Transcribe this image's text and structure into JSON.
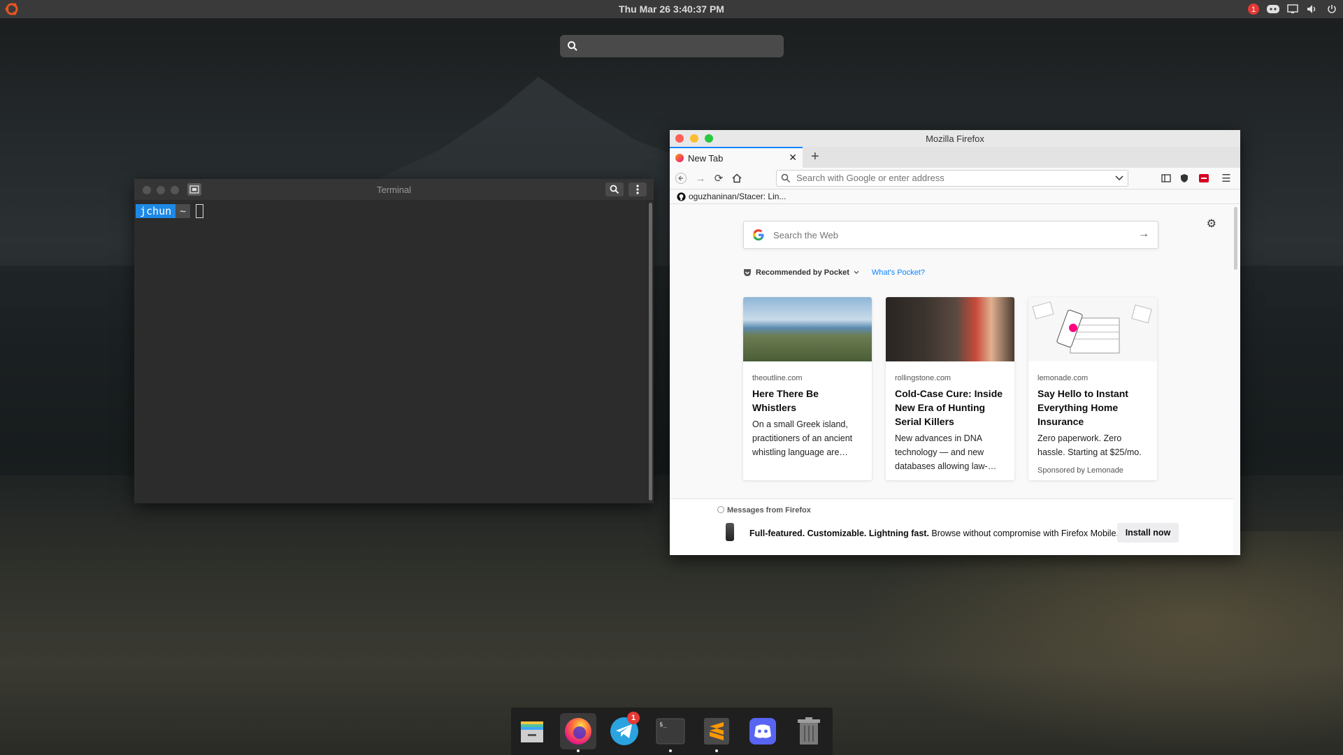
{
  "topbar": {
    "clock": "Thu Mar 26   3:40:37 PM",
    "notification_count": "1"
  },
  "top_search": {
    "value": ""
  },
  "terminal": {
    "title": "Terminal",
    "prompt_user": "jchun",
    "prompt_dir": "~"
  },
  "firefox": {
    "window_title": "Mozilla Firefox",
    "tab_label": "New Tab",
    "url_placeholder": "Search with Google or enter address",
    "bookmark": "oguzhaninan/Stacer: Lin...",
    "web_search_placeholder": "Search the Web",
    "pocket_heading": "Recommended by Pocket",
    "whats_pocket": "What's Pocket?",
    "cards": [
      {
        "source": "theoutline.com",
        "title": "Here There Be Whistlers",
        "desc": "On a small Greek island, practitioners of an ancient whistling language are…",
        "sponsored": ""
      },
      {
        "source": "rollingstone.com",
        "title": "Cold-Case Cure: Inside New Era of Hunting Serial Killers",
        "desc": "New advances in DNA technology — and new databases allowing law-…",
        "sponsored": ""
      },
      {
        "source": "lemonade.com",
        "title": "Say Hello to Instant Everything Home Insurance",
        "desc": "Zero paperwork. Zero hassle. Starting at $25/mo.",
        "sponsored": "Sponsored by Lemonade"
      }
    ],
    "message": {
      "header": "Messages from Firefox",
      "bold": "Full-featured. Customizable. Lightning fast.",
      "text": " Browse without compromise with Firefox Mobile.",
      "button": "Install now"
    }
  },
  "dock": {
    "telegram_badge": "1",
    "items": [
      "files-icon",
      "firefox-icon",
      "telegram-icon",
      "terminal-icon",
      "sublime-text-icon",
      "discord-icon",
      "trash-icon"
    ]
  },
  "colors": {
    "accent": "#0a84ff",
    "close": "#fd5f57",
    "minimize": "#febc2e",
    "maximize": "#28c840",
    "prompt_user_bg": "#1e88e5"
  }
}
